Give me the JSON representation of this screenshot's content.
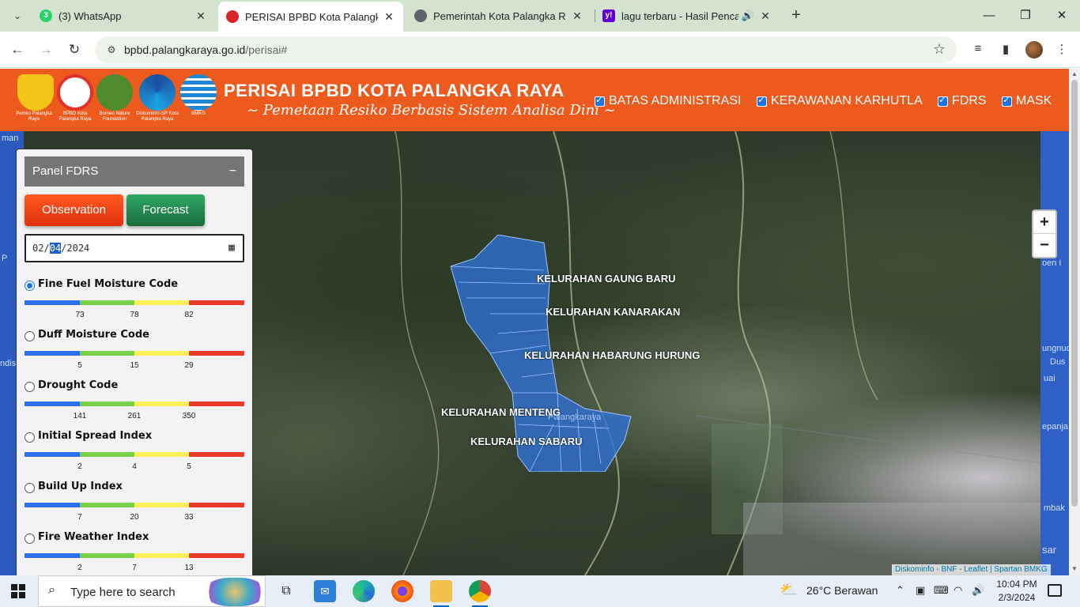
{
  "browser": {
    "tabs": [
      {
        "label": "(3) WhatsApp",
        "close": "✕",
        "icon": "whatsapp-icon",
        "badge": "3",
        "color": "#25d366"
      },
      {
        "label": "PERISAI BPBD Kota Palangka Raya",
        "close": "✕",
        "icon": "bpbd-icon",
        "color": "#d9252a"
      },
      {
        "label": "Pemerintah Kota Palangka Raya",
        "close": "✕",
        "icon": "globe-icon",
        "color": "#5f6368"
      },
      {
        "label": "lagu terbaru - Hasil Pencarian",
        "close": "✕",
        "icon": "yahoo-icon",
        "badge": "y!",
        "color": "#6001d2"
      }
    ],
    "url_host": "bpbd.palangkaraya.go.id",
    "url_path": "/perisai#"
  },
  "header": {
    "title": "PERISAI BPBD KOTA PALANGKA RAYA",
    "subtitle": "~ Pemetaan Resiko Berbasis Sistem Analisa Dini ~",
    "logos": [
      {
        "caption": "Pemko Palangka Raya",
        "color": "#f2c318"
      },
      {
        "caption": "BPBD Kota Palangka Raya",
        "color": "#e2322a"
      },
      {
        "caption": "Borneo Nature Foundation",
        "color": "#4f8a2b"
      },
      {
        "caption": "Diskominfo-SP Kota Palangka Raya",
        "color": "#1d4e9e"
      },
      {
        "caption": "BMKG",
        "color": "#1e88d6"
      }
    ],
    "layers": [
      {
        "label": "BATAS ADMINISTRASI",
        "checked": true
      },
      {
        "label": "KERAWANAN KARHUTLA",
        "checked": true
      },
      {
        "label": "FDRS",
        "checked": true
      },
      {
        "label": "MASK",
        "checked": true
      }
    ]
  },
  "panel": {
    "title": "Panel FDRS",
    "minimize": "−",
    "observation": "Observation",
    "forecast": "Forecast",
    "date_month": "02",
    "date_day": "04",
    "date_year": "2024",
    "indices": [
      {
        "name": "Fine Fuel Moisture Code",
        "checked": true,
        "ticks": [
          "73",
          "78",
          "82"
        ]
      },
      {
        "name": "Duff Moisture Code",
        "checked": false,
        "ticks": [
          "5",
          "15",
          "29"
        ]
      },
      {
        "name": "Drought Code",
        "checked": false,
        "ticks": [
          "141",
          "261",
          "350"
        ]
      },
      {
        "name": "Initial Spread Index",
        "checked": false,
        "ticks": [
          "2",
          "4",
          "5"
        ]
      },
      {
        "name": "Build Up Index",
        "checked": false,
        "ticks": [
          "7",
          "20",
          "33"
        ]
      },
      {
        "name": "Fire Weather Index",
        "checked": false,
        "ticks": [
          "2",
          "7",
          "13"
        ]
      }
    ],
    "scale_colors": [
      "#2f6fef",
      "#7ad04b",
      "#fbf05a",
      "#eb3a2a"
    ]
  },
  "map": {
    "labels": [
      "KELURAHAN GAUNG BARU",
      "KELURAHAN KANARAKAN",
      "KELURAHAN HABARUNG HURUNG",
      "KELURAHAN MENTENG",
      "KELURAHAN SABARU"
    ],
    "city_label": "Palangkaraya",
    "edge_left_labels": [
      "man",
      "P",
      "ndis"
    ],
    "edge_right_labels": [
      "oen I",
      "ungnuc",
      "Dus",
      "uai",
      "epanja",
      "mbak",
      "sar"
    ],
    "zoom_in": "+",
    "zoom_out": "−",
    "attribution": "Diskominfo - BNF - Leaflet | Spartan BMKG"
  },
  "taskbar": {
    "search_placeholder": "Type here to search",
    "weather": "26°C  Berawan",
    "time": "10:04 PM",
    "date": "2/3/2024"
  }
}
